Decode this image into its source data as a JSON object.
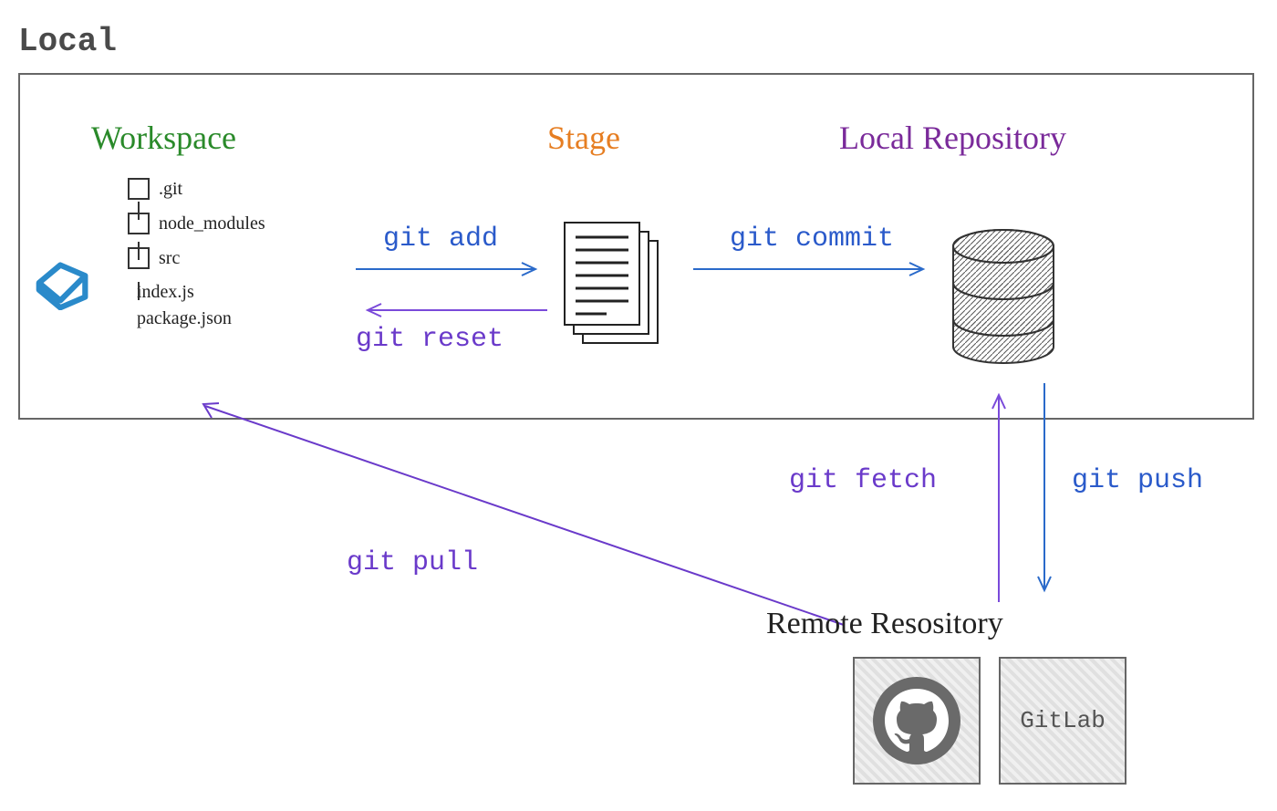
{
  "local_label": "Local",
  "sections": {
    "workspace": "Workspace",
    "stage": "Stage",
    "local_repo": "Local Repository",
    "remote_repo": "Remote Resository"
  },
  "file_tree": {
    "folders": [
      ".git",
      "node_modules",
      "src"
    ],
    "files": [
      "index.js",
      "package.json"
    ]
  },
  "commands": {
    "add": "git add",
    "commit": "git commit",
    "reset": "git reset",
    "fetch": "git fetch",
    "push": "git push",
    "pull": "git pull"
  },
  "remote_services": {
    "gitlab": "GitLab"
  },
  "colors": {
    "workspace": "#2a8a2a",
    "stage": "#e67e22",
    "local_repo": "#7a2a9a",
    "blue_cmd": "#2a5aca",
    "purple_cmd": "#6a3aca"
  }
}
